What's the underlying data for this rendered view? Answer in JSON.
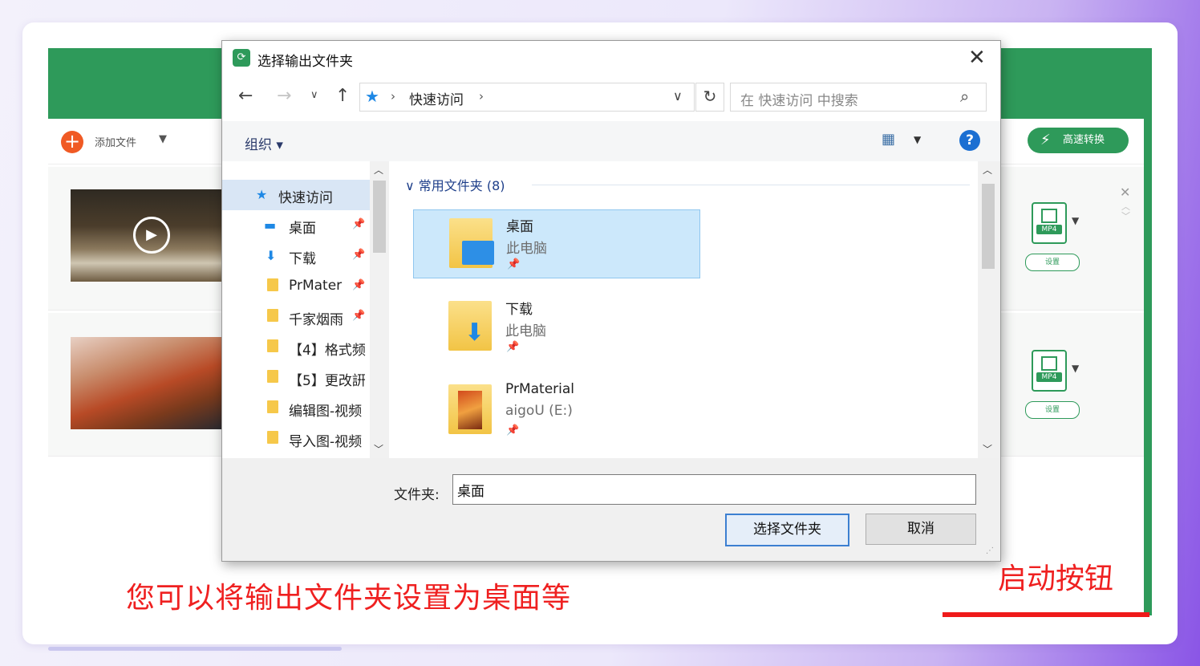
{
  "app": {
    "add_file_label": "添加文件",
    "turbo_label": "高速转换",
    "format_badge": "MP4",
    "settings_label": "设置"
  },
  "dialog": {
    "title": "选择输出文件夹",
    "address_crumb": "快速访问",
    "search_placeholder": "在 快速访问 中搜索",
    "organize_label": "组织 ▾",
    "help_glyph": "?",
    "nav_items": [
      {
        "label": "快速访问"
      },
      {
        "label": "桌面"
      },
      {
        "label": "下载"
      },
      {
        "label": "PrMater"
      },
      {
        "label": "千家烟雨"
      },
      {
        "label": "【4】格式频"
      },
      {
        "label": "【5】更改詽"
      },
      {
        "label": "编辑图-视频"
      },
      {
        "label": "导入图-视频"
      }
    ],
    "group_header": "常用文件夹 (8)",
    "tiles": [
      {
        "name": "桌面",
        "sub": "此电脑"
      },
      {
        "name": "下载",
        "sub": "此电脑"
      },
      {
        "name": "PrMaterial",
        "sub": "aigoU (E:)"
      }
    ],
    "folder_label": "文件夹:",
    "folder_value": "桌面",
    "select_button": "选择文件夹",
    "cancel_button": "取消"
  },
  "captions": {
    "left": "您可以将输出文件夹设置为桌面等",
    "right": "启动按钮"
  },
  "colors": {
    "brand_green": "#2e9a5a",
    "caption_red": "#ef2020",
    "selection_blue": "#cce8fb"
  }
}
